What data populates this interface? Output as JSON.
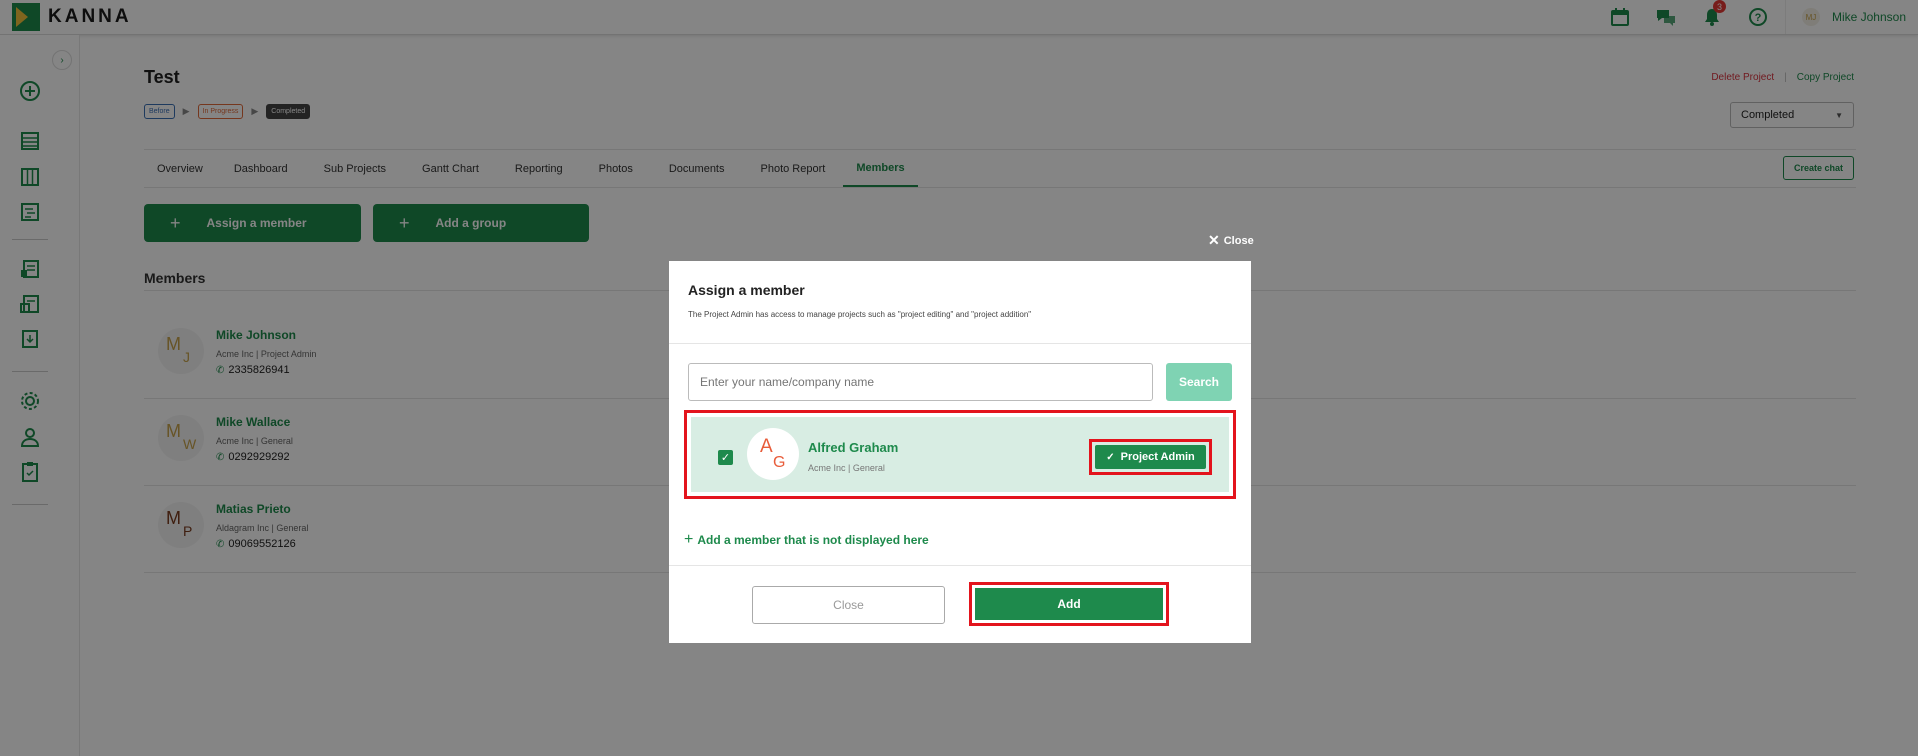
{
  "app": {
    "logo_text": "KANNA"
  },
  "header": {
    "user_name": "Mike Johnson",
    "user_initials": "MJ",
    "notification_count": "3"
  },
  "project": {
    "title": "Test",
    "steps": [
      "Before",
      "In Progress",
      "Completed"
    ],
    "delete_label": "Delete Project",
    "copy_label": "Copy Project",
    "status_value": "Completed"
  },
  "tabs": [
    "Overview",
    "Dashboard",
    "Sub Projects",
    "Gantt Chart",
    "Reporting",
    "Photos",
    "Documents",
    "Photo Report",
    "Members"
  ],
  "active_tab": "Members",
  "create_chat_label": "Create chat",
  "actions": {
    "assign_member": "Assign a member",
    "add_group": "Add a group"
  },
  "members_heading": "Members",
  "members": [
    {
      "name": "Mike Johnson",
      "initial1": "M",
      "initial2": "J",
      "subtitle": "Acme Inc | Project Admin",
      "phone": "2335826941",
      "color": "#c6a24a"
    },
    {
      "name": "Mike Wallace",
      "initial1": "M",
      "initial2": "W",
      "subtitle": "Acme Inc | General",
      "phone": "0292929292",
      "color": "#c6a24a"
    },
    {
      "name": "Matias Prieto",
      "initial1": "M",
      "initial2": "P",
      "subtitle": "Aldagram Inc | General",
      "phone": "09069552126",
      "color": "#7a3b1e"
    }
  ],
  "modal": {
    "close_top_label": "Close",
    "title": "Assign a member",
    "description": "The Project Admin has access to manage projects such as \"project editing\" and \"project addition\"",
    "search_placeholder": "Enter your name/company name",
    "search_label": "Search",
    "result": {
      "name": "Alfred Graham",
      "initial1": "A",
      "initial2": "G",
      "subtitle": "Acme Inc |  General",
      "role_label": "Project Admin"
    },
    "add_member_link": "Add a member that is not displayed here",
    "close_label": "Close",
    "add_label": "Add"
  },
  "colors": {
    "brand": "#1e8a4c",
    "highlight": "#e3141d"
  }
}
